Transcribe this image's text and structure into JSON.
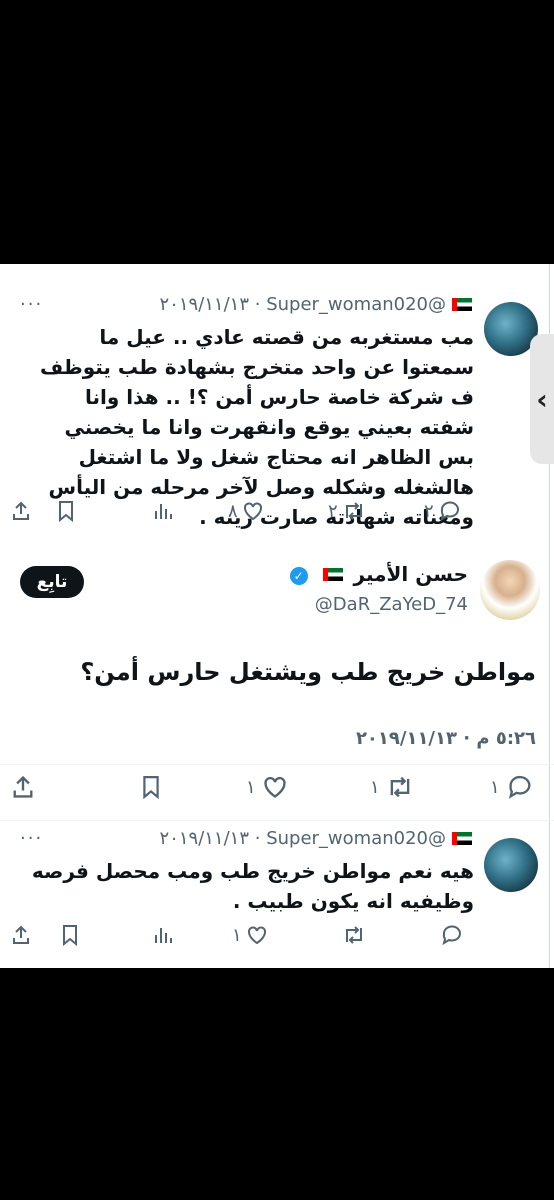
{
  "tweet1": {
    "handle": "@Super_woman020",
    "date": "٢٠١٩/١١/١٣",
    "more": "···",
    "text": "مب مستغربه من قصته عادي .. عيل ما سمعتوا عن واحد متخرج بشهادة طب يتوظف ف شركة خاصة حارس أمن ؟! .. هذا وانا شفته بعيني يوقع وانقهرت وانا ما يخصني بس الظاهر انه محتاج شغل ولا ما اشتغل هالشغله وشكله وصل لآخر مرحله من اليأس ومعناته شهادته صارت زينه .",
    "replies": "٢",
    "retweets": "٢",
    "likes": "٨"
  },
  "tweet2": {
    "name": "حسن الأمير",
    "handle": "@DaR_ZaYeD_74",
    "follow_label": "تابِع",
    "text": "مواطن خريج طب ويشتغل حارس أمن؟",
    "timestamp": "٥:٢٦ م · ٢٠١٩/١١/١٣",
    "replies": "١",
    "retweets": "١",
    "likes": "١"
  },
  "tweet3": {
    "handle": "@Super_woman020",
    "date": "٢٠١٩/١١/١٣",
    "more": "···",
    "text": "هيه نعم مواطن خريج طب ومب محصل فرصه وظيفيه انه يكون طبيب .",
    "likes": "١"
  },
  "icons": [
    "reply-icon",
    "retweet-icon",
    "like-icon",
    "views-icon",
    "bookmark-icon",
    "share-icon",
    "chevron-left-icon",
    "verified-icon",
    "uae-flag-icon"
  ]
}
